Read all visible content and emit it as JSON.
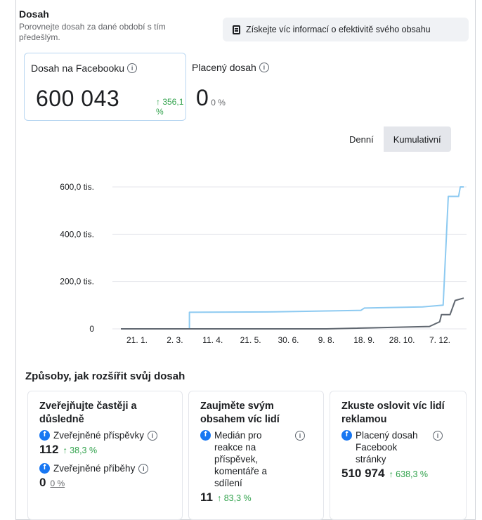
{
  "header": {
    "title": "Dosah",
    "subtitle": "Porovnejte dosah za dané období s tím předešlým.",
    "info_button": "Získejte víc informací o efektivitě svého obsahu"
  },
  "metrics": {
    "fb_reach_label": "Dosah na Facebooku",
    "fb_reach_value": "600 043",
    "fb_reach_delta": "↑ 356,1 %",
    "paid_reach_label": "Placený dosah",
    "paid_reach_value": "0",
    "paid_reach_pct": "0 %"
  },
  "toggle": {
    "daily": "Denní",
    "cumulative": "Kumulativní",
    "selected": "Kumulativní"
  },
  "chart_data": {
    "type": "line",
    "y_ticks": [
      "600,0 tis.",
      "400,0 tis.",
      "200,0 tis.",
      "0"
    ],
    "ylim": [
      0,
      600000
    ],
    "x_ticks": [
      "21. 1.",
      "2. 3.",
      "11. 4.",
      "21. 5.",
      "30. 6.",
      "9. 8.",
      "18. 9.",
      "28. 10.",
      "7. 12."
    ],
    "series": [
      {
        "color": "#8dcaf1",
        "values": [
          [
            0.0,
            0
          ],
          [
            0.2,
            0
          ],
          [
            0.2,
            70000
          ],
          [
            0.45,
            72000
          ],
          [
            0.7,
            78000
          ],
          [
            0.71,
            88000
          ],
          [
            0.88,
            93000
          ],
          [
            0.94,
            100000
          ],
          [
            0.955,
            560000
          ],
          [
            0.985,
            560000
          ],
          [
            0.99,
            600043
          ],
          [
            1.0,
            600043
          ]
        ]
      },
      {
        "color": "#606770",
        "values": [
          [
            0.0,
            0
          ],
          [
            0.6,
            0
          ],
          [
            0.9,
            10000
          ],
          [
            0.93,
            30000
          ],
          [
            0.935,
            60000
          ],
          [
            0.96,
            60000
          ],
          [
            0.975,
            120000
          ],
          [
            1.0,
            130000
          ]
        ]
      }
    ]
  },
  "ways": {
    "title": "Způsoby, jak rozšířit svůj dosah",
    "tips": [
      {
        "heading": "Zveřejňujte častěji a důsledně",
        "items": [
          {
            "label": "Zveřejněné příspěvky",
            "value": "112",
            "delta": "↑ 38,3 %"
          },
          {
            "label": "Zveřejněné příběhy",
            "value": "0",
            "delta": "0 %"
          }
        ]
      },
      {
        "heading": "Zaujměte svým obsahem víc lidí",
        "items": [
          {
            "label": "Medián pro reakce na příspěvek, komentáře a sdílení",
            "value": "11",
            "delta": "↑ 83,3 %"
          }
        ]
      },
      {
        "heading": "Zkuste oslovit víc lidí reklamou",
        "items": [
          {
            "label": "Placený dosah Facebook stránky",
            "value": "510 974",
            "delta": "↑ 638,3 %"
          }
        ]
      }
    ]
  }
}
